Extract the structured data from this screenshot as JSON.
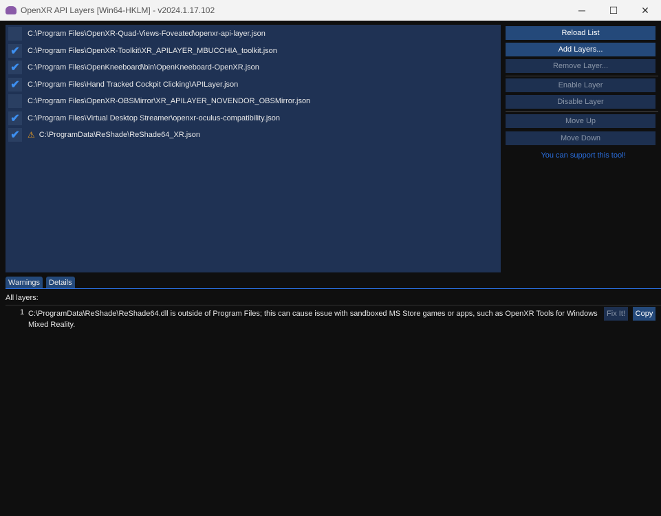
{
  "window": {
    "title": "OpenXR API Layers [Win64-HKLM] - v2024.1.17.102",
    "minimize": "─",
    "maximize": "☐",
    "close": "✕"
  },
  "layers": [
    {
      "path": "C:\\Program Files\\OpenXR-Quad-Views-Foveated\\openxr-api-layer.json",
      "enabled": false,
      "warning": false
    },
    {
      "path": "C:\\Program Files\\OpenXR-Toolkit\\XR_APILAYER_MBUCCHIA_toolkit.json",
      "enabled": true,
      "warning": false
    },
    {
      "path": "C:\\Program Files\\OpenKneeboard\\bin\\OpenKneeboard-OpenXR.json",
      "enabled": true,
      "warning": false
    },
    {
      "path": "C:\\Program Files\\Hand Tracked Cockpit Clicking\\APILayer.json",
      "enabled": true,
      "warning": false
    },
    {
      "path": "C:\\Program Files\\OpenXR-OBSMirror\\XR_APILAYER_NOVENDOR_OBSMirror.json",
      "enabled": false,
      "warning": false
    },
    {
      "path": "C:\\Program Files\\Virtual Desktop Streamer\\openxr-oculus-compatibility.json",
      "enabled": true,
      "warning": false
    },
    {
      "path": "C:\\ProgramData\\ReShade\\ReShade64_XR.json",
      "enabled": true,
      "warning": true
    }
  ],
  "buttons": {
    "reload": "Reload List",
    "add": "Add Layers...",
    "remove": "Remove Layer...",
    "enable": "Enable Layer",
    "disable": "Disable Layer",
    "up": "Move Up",
    "down": "Move Down"
  },
  "support_link": "You can support this tool!",
  "tabs": {
    "warnings": "Warnings",
    "details": "Details"
  },
  "warnings": {
    "heading": "All layers:",
    "items": [
      {
        "num": "1",
        "text": "C:\\ProgramData\\ReShade\\ReShade64.dll is outside of Program Files; this can cause issue with sandboxed MS Store games or apps, such as OpenXR Tools for Windows Mixed Reality.",
        "fix": "Fix It!",
        "copy": "Copy"
      }
    ]
  },
  "colors": {
    "accent": "#24497a",
    "link": "#2a6fe0",
    "list_bg": "#1f3254",
    "check": "#3d8ff0",
    "warning": "#f0a020"
  }
}
